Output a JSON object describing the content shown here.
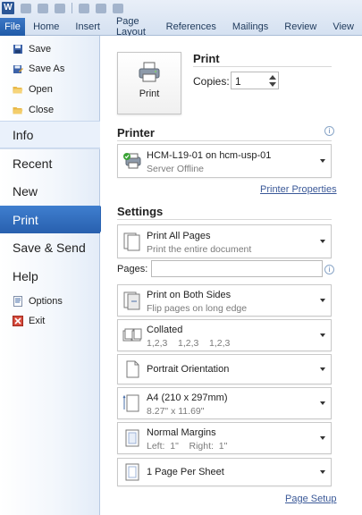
{
  "app": {
    "icon_letter": "W"
  },
  "ribbon": {
    "tabs": [
      "File",
      "Home",
      "Insert",
      "Page Layout",
      "References",
      "Mailings",
      "Review",
      "View"
    ]
  },
  "nav": {
    "commands_top": [
      {
        "label": "Save",
        "icon": "save-icon"
      },
      {
        "label": "Save As",
        "icon": "save-as-icon"
      },
      {
        "label": "Open",
        "icon": "open-folder-icon"
      },
      {
        "label": "Close",
        "icon": "close-document-icon"
      }
    ],
    "items": [
      "Info",
      "Recent",
      "New",
      "Print",
      "Save & Send",
      "Help"
    ],
    "selected": "Print",
    "commands_bottom": [
      {
        "label": "Options",
        "icon": "options-icon"
      },
      {
        "label": "Exit",
        "icon": "exit-icon"
      }
    ]
  },
  "print": {
    "button_label": "Print",
    "heading": "Print",
    "copies_label": "Copies:",
    "copies_value": "1"
  },
  "printer": {
    "heading": "Printer",
    "name": "HCM-L19-01 on hcm-usp-01",
    "status": "Server Offline",
    "properties_link": "Printer Properties"
  },
  "settings": {
    "heading": "Settings",
    "pages_label": "Pages:",
    "pages_value": "",
    "options": [
      {
        "title": "Print All Pages",
        "subtitle": "Print the entire document",
        "icon": "pages-icon"
      },
      {
        "title": "Print on Both Sides",
        "subtitle": "Flip pages on long edge",
        "icon": "duplex-icon"
      },
      {
        "title": "Collated",
        "subtitle": "1,2,3    1,2,3    1,2,3",
        "icon": "collate-icon"
      },
      {
        "title": "Portrait Orientation",
        "subtitle": "",
        "icon": "portrait-icon"
      },
      {
        "title": "A4 (210 x 297mm)",
        "subtitle": "8.27\" x 11.69\"",
        "icon": "paper-size-icon"
      },
      {
        "title": "Normal Margins",
        "subtitle": "Left:  1\"    Right:  1\"",
        "icon": "margins-icon"
      },
      {
        "title": "1 Page Per Sheet",
        "subtitle": "",
        "icon": "pages-per-sheet-icon"
      }
    ],
    "page_setup_link": "Page Setup"
  },
  "colors": {
    "accent": "#2b64b0",
    "link": "#3b5998"
  }
}
